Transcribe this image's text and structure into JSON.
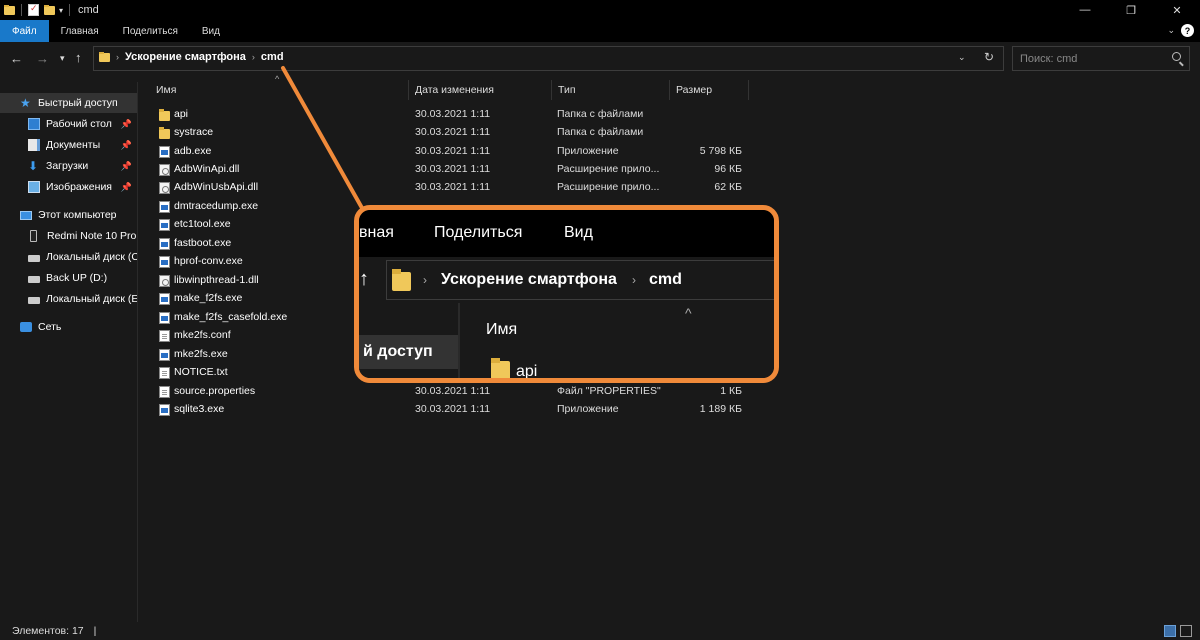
{
  "window": {
    "title": "cmd",
    "controls": {
      "minimize": "—",
      "maximize": "❐",
      "close": "✕"
    }
  },
  "ribbon": {
    "tabs": [
      "Файл",
      "Главная",
      "Поделиться",
      "Вид"
    ],
    "expand_icon": "chevron-down-icon",
    "help_icon": "help-icon"
  },
  "address": {
    "breadcrumbs": [
      "Ускорение смартфона",
      "cmd"
    ]
  },
  "search": {
    "placeholder": "Поиск: cmd"
  },
  "sidebar": {
    "items": [
      {
        "label": "Быстрый доступ",
        "icon": "star-icon",
        "active": true
      },
      {
        "label": "Рабочий стол",
        "icon": "desktop-icon",
        "pinned": true
      },
      {
        "label": "Документы",
        "icon": "documents-icon",
        "pinned": true
      },
      {
        "label": "Загрузки",
        "icon": "downloads-icon",
        "pinned": true
      },
      {
        "label": "Изображения",
        "icon": "pictures-icon",
        "pinned": true
      },
      {
        "label": "Этот компьютер",
        "icon": "computer-icon"
      },
      {
        "label": "Redmi Note 10 Pro",
        "icon": "phone-icon"
      },
      {
        "label": "Локальный диск (C",
        "icon": "drive-icon"
      },
      {
        "label": "Back UP (D:)",
        "icon": "drive-icon"
      },
      {
        "label": "Локальный диск (E",
        "icon": "drive-icon"
      },
      {
        "label": "Сеть",
        "icon": "network-icon"
      }
    ]
  },
  "columns": {
    "name": "Имя",
    "date": "Дата изменения",
    "type": "Тип",
    "size": "Размер"
  },
  "files": [
    {
      "name": "api",
      "date": "30.03.2021 1:11",
      "type": "Папка с файлами",
      "size": "",
      "kind": "folder"
    },
    {
      "name": "systrace",
      "date": "30.03.2021 1:11",
      "type": "Папка с файлами",
      "size": "",
      "kind": "folder"
    },
    {
      "name": "adb.exe",
      "date": "30.03.2021 1:11",
      "type": "Приложение",
      "size": "5 798 КБ",
      "kind": "exe"
    },
    {
      "name": "AdbWinApi.dll",
      "date": "30.03.2021 1:11",
      "type": "Расширение прило...",
      "size": "96 КБ",
      "kind": "dll"
    },
    {
      "name": "AdbWinUsbApi.dll",
      "date": "30.03.2021 1:11",
      "type": "Расширение прило...",
      "size": "62 КБ",
      "kind": "dll"
    },
    {
      "name": "dmtracedump.exe",
      "date": "",
      "type": "",
      "size": "",
      "kind": "exe"
    },
    {
      "name": "etc1tool.exe",
      "date": "",
      "type": "",
      "size": "",
      "kind": "exe"
    },
    {
      "name": "fastboot.exe",
      "date": "",
      "type": "",
      "size": "",
      "kind": "exe"
    },
    {
      "name": "hprof-conv.exe",
      "date": "",
      "type": "",
      "size": "",
      "kind": "exe"
    },
    {
      "name": "libwinpthread-1.dll",
      "date": "",
      "type": "",
      "size": "",
      "kind": "dll"
    },
    {
      "name": "make_f2fs.exe",
      "date": "",
      "type": "",
      "size": "",
      "kind": "exe"
    },
    {
      "name": "make_f2fs_casefold.exe",
      "date": "",
      "type": "",
      "size": "",
      "kind": "exe"
    },
    {
      "name": "mke2fs.conf",
      "date": "",
      "type": "",
      "size": "",
      "kind": "file"
    },
    {
      "name": "mke2fs.exe",
      "date": "",
      "type": "",
      "size": "",
      "kind": "exe"
    },
    {
      "name": "NOTICE.txt",
      "date": "",
      "type": "",
      "size": "",
      "kind": "file"
    },
    {
      "name": "source.properties",
      "date": "30.03.2021 1:11",
      "type": "Файл \"PROPERTIES\"",
      "size": "1 КБ",
      "kind": "file"
    },
    {
      "name": "sqlite3.exe",
      "date": "30.03.2021 1:11",
      "type": "Приложение",
      "size": "1 189 КБ",
      "kind": "exe"
    }
  ],
  "status": {
    "items_count": "Элементов: 17"
  },
  "callout": {
    "accent": "#f08a3a",
    "ribbon_tabs": [
      "вная",
      "Поделиться",
      "Вид"
    ],
    "breadcrumbs": [
      "Ускорение смартфона",
      "cmd"
    ],
    "column_name": "Имя",
    "sidebar_label": "й доступ",
    "file_name": "api"
  }
}
